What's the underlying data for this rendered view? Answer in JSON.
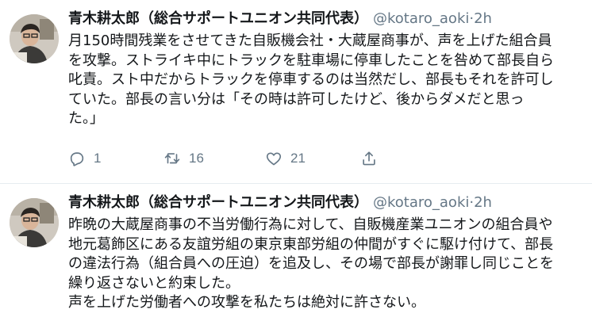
{
  "tweets": [
    {
      "author_name": "青木耕太郎（総合サポートユニオン共同代表）",
      "handle": "@kotaro_aoki",
      "separator": "·",
      "time": "2h",
      "text": "月150時間残業をさせてきた自販機会社・大蔵屋商事が、声を上げた組合員\nを攻撃。ストライキ中にトラックを駐車場に停車したことを咎めて部長自ら\n叱責。スト中だからトラックを停車するのは当然だし、部長もそれを許可し\nていた。部長の言い分は「その時は許可したけど、後からダメだと思っ\nた。」",
      "replies": "1",
      "retweets": "16",
      "likes": "21"
    },
    {
      "author_name": "青木耕太郎（総合サポートユニオン共同代表）",
      "handle": "@kotaro_aoki",
      "separator": "·",
      "time": "2h",
      "text": "昨晩の大蔵屋商事の不当労働行為に対して、自販機産業ユニオンの組合員や\n地元葛飾区にある友誼労組の東京東部労組の仲間がすぐに駆け付けて、部長\nの違法行為（組合員への圧迫）を追及し、その場で部長が謝罪し同じことを\n繰り返さないと約束した。\n声を上げた労働者への攻撃を私たちは絶対に許さない。"
    }
  ],
  "icons": {
    "reply": "reply-icon",
    "retweet": "retweet-icon",
    "like": "heart-icon",
    "share": "share-icon"
  },
  "colors": {
    "text": "#14171a",
    "secondary": "#657786",
    "border": "#e6ecf0"
  }
}
